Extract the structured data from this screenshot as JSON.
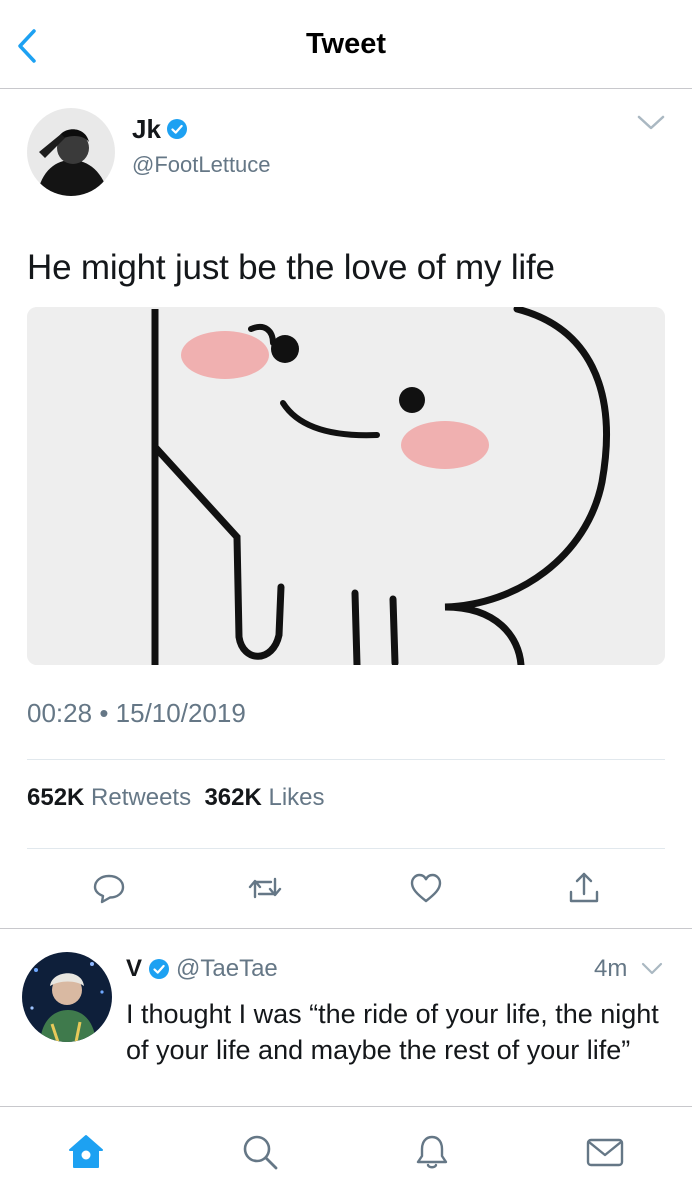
{
  "nav": {
    "title": "Tweet",
    "back_icon": "chevron-left-icon"
  },
  "tweet": {
    "author_name": "Jk",
    "author_handle": "@FootLettuce",
    "verified": true,
    "text": "He might just be the love of my life",
    "time": "00:28",
    "separator": "•",
    "date": "15/10/2019",
    "retweets_count": "652K",
    "retweets_label": "Retweets",
    "likes_count": "362K",
    "likes_label": "Likes",
    "actions": [
      "reply-icon",
      "retweet-icon",
      "like-icon",
      "share-icon"
    ]
  },
  "reply": {
    "author_name": "V",
    "author_handle": "@TaeTae",
    "verified": true,
    "time_ago": "4m",
    "text": "I thought I was “the ride of your life, the night of your life and maybe the rest of your life”"
  },
  "tabbar": {
    "items": [
      "home-icon",
      "search-icon",
      "notifications-icon",
      "messages-icon"
    ],
    "active": "home-icon"
  },
  "colors": {
    "accent": "#1da1f2",
    "muted": "#657786",
    "divider": "#e1e8ed",
    "text": "#14171a",
    "blush": "#f0a9a9"
  }
}
